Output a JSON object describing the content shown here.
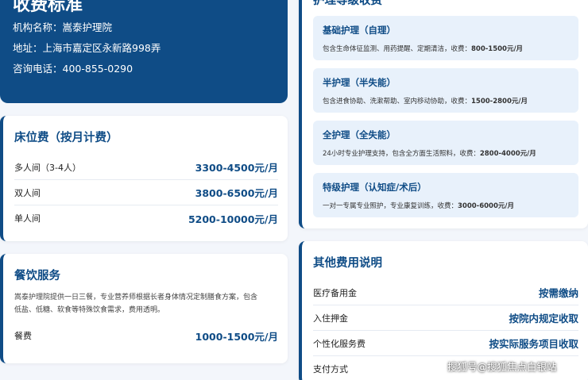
{
  "header": {
    "title": "收费标准",
    "institution_label": "机构名称：嵩泰护理院",
    "address_label": "地址：上海市嘉定区永新路998弄",
    "phone_label": "咨询电话：400-855-0290"
  },
  "bed_fees": {
    "title": "床位费（按月计费）",
    "rows": [
      {
        "name": "多人间（3-4人）",
        "price": "3300-4500元/月"
      },
      {
        "name": "双人间",
        "price": "3800-6500元/月"
      },
      {
        "name": "单人间",
        "price": "5200-10000元/月"
      }
    ]
  },
  "food": {
    "title": "餐饮服务",
    "description_line1": "嵩泰护理院提供一日三餐，专业营养师根据长者身体情况定制膳食方案，包含",
    "description_line2": "低盐、低糖、软食等特殊饮食需求，费用透明。",
    "row": {
      "name": "餐费",
      "price": "1000-1500元/月"
    }
  },
  "care": {
    "title": "护理等级收费",
    "items": [
      {
        "name": "基础护理（自理）",
        "desc": "包含生命体征监测、用药提醒、定期清洁，收费：",
        "price": "800-1500元/月"
      },
      {
        "name": "半护理（半失能）",
        "desc": "包含进食协助、洗漱帮助、室内移动协助，收费：",
        "price": "1500-2800元/月"
      },
      {
        "name": "全护理（全失能）",
        "desc": "24小时专业护理支持，包含全方面生活照料，收费：",
        "price": "2800-4000元/月"
      },
      {
        "name": "特级护理（认知症/术后）",
        "desc": "一对一专属专业照护，专业康复训练，收费：",
        "price": "3000-6000元/月"
      }
    ]
  },
  "other": {
    "title": "其他费用说明",
    "rows": [
      {
        "name": "医疗备用金",
        "price": "按需缴纳"
      },
      {
        "name": "入住押金",
        "price": "按院内规定收取"
      },
      {
        "name": "个性化服务费",
        "price": "按实际服务项目收取"
      },
      {
        "name": "支付方式",
        "price": ""
      }
    ]
  },
  "watermark": "搜狐号@搜狐焦点白银站",
  "colors": {
    "accent": "#0f4c86",
    "item_bg": "#e8f1fb"
  }
}
